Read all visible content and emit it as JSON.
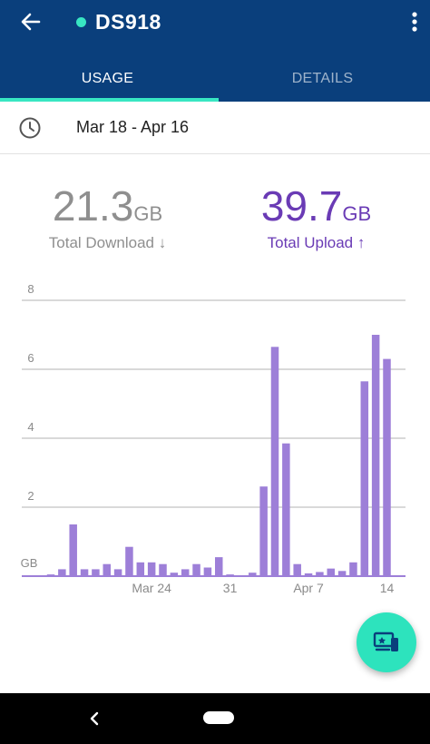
{
  "header": {
    "title": "DS918",
    "status_color": "#38e6c2",
    "back_icon": "arrow-left-icon",
    "menu_icon": "more-vertical-icon"
  },
  "tabs": [
    {
      "label": "USAGE",
      "active": true
    },
    {
      "label": "DETAILS",
      "active": false
    }
  ],
  "date_range": {
    "icon": "clock-icon",
    "label": "Mar 18 - Apr 16"
  },
  "stats": {
    "download": {
      "value": "21.3",
      "unit": "GB",
      "label": "Total Download ↓",
      "color": "#8f8f8f"
    },
    "upload": {
      "value": "39.7",
      "unit": "GB",
      "label": "Total Upload ↑",
      "color": "#6a3bb5"
    }
  },
  "chart_data": {
    "type": "bar",
    "ylabel": "GB",
    "ylim": [
      0,
      8
    ],
    "yticks": [
      "2",
      "4",
      "6",
      "8"
    ],
    "xtick_labels": [
      {
        "label": "Mar 24",
        "index": 9
      },
      {
        "label": "31",
        "index": 16
      },
      {
        "label": "Apr 7",
        "index": 23
      },
      {
        "label": "14",
        "index": 30
      }
    ],
    "bar_color": "#9d7fd8",
    "grid": true,
    "values": [
      0.05,
      0.2,
      1.5,
      0.2,
      0.2,
      0.35,
      0.2,
      0.85,
      0.4,
      0.4,
      0.35,
      0.1,
      0.2,
      0.35,
      0.25,
      0.55,
      0.05,
      0.02,
      0.1,
      2.6,
      6.65,
      3.85,
      0.35,
      0.08,
      0.12,
      0.22,
      0.15,
      0.4,
      5.65,
      7.0,
      6.3
    ]
  },
  "fab": {
    "icon": "devices-cast-icon",
    "color": "#2de3bd"
  },
  "system_nav": {
    "back_icon": "chevron-left-icon",
    "home_icon": "home-pill-icon"
  }
}
